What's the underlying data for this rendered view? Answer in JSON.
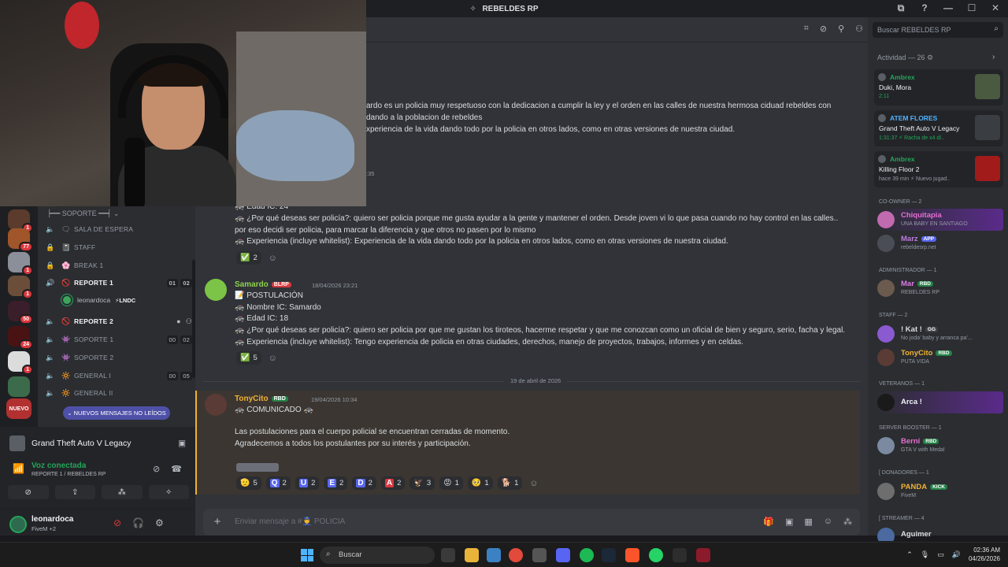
{
  "window": {
    "title": "REBELDES RP",
    "controls": [
      "⧉",
      "?",
      "—",
      "☐",
      "✕"
    ]
  },
  "sidebar": {
    "category": "SOPORTE",
    "channels": [
      {
        "emoji": "🗨",
        "name": "SALA DE ESPERA",
        "bold": false,
        "counts": []
      },
      {
        "emoji": "📓",
        "name": "STAFF",
        "bold": false,
        "counts": []
      },
      {
        "emoji": "🌸",
        "name": "BREAK 1",
        "bold": false,
        "counts": []
      },
      {
        "emoji": "🚫",
        "name": "REPORTE 1",
        "bold": true,
        "counts": [
          "01",
          "02"
        ]
      },
      {
        "emoji": "🚫",
        "name": "REPORTE 2",
        "bold": true,
        "counts": []
      },
      {
        "emoji": "👾",
        "name": "SOPORTE 1",
        "bold": false,
        "counts": [
          "00",
          "02"
        ]
      },
      {
        "emoji": "👾",
        "name": "SOPORTE 2",
        "bold": false,
        "counts": []
      },
      {
        "emoji": "🔆",
        "name": "GENERAL I",
        "bold": false,
        "counts": [
          "00",
          "05"
        ]
      },
      {
        "emoji": "🔆",
        "name": "GENERAL II",
        "bold": false,
        "counts": []
      }
    ],
    "voice_user": {
      "name": "leonardoca",
      "tag": "⚡LNDC"
    },
    "new_messages_label": "NUEVOS MENSAJES NO LEÍDOS",
    "rail_badges": [
      "1",
      "77",
      "1",
      "1",
      "50",
      "24",
      "1"
    ],
    "rail_new_label": "NUEVO"
  },
  "voice_panel": {
    "game": "Grand Theft Auto V Legacy",
    "status": "Voz conectada",
    "channel": "REPORTE 1 / REBELDES RP",
    "user_name": "leonardoca",
    "user_status": "FiveM +2"
  },
  "chat": {
    "channel_placeholder": "Enviar mensaje a #👮 POLICIA",
    "messages_top": [
      "ardo es un policia muy respetuoso con la dedicacion a cumplir la ley y el orden en las calles de nuestra hermosa ciduad rebeldes con",
      "dando a la poblacion de rebeldes",
      "xperiencia de la vida dando todo por la policia en otros lados, como en otras versiones de nuestra ciudad."
    ],
    "partial_time": ":35",
    "msg2_lines": [
      "🚓 Edad IC: 24",
      "🚓 ¿Por qué deseas ser policía?: quiero ser policia porque me gusta ayudar a la gente y mantener el orden. Desde joven vi lo que pasa cuando no hay control en las calles..",
      "por eso decidi ser policia, para marcar la diferencia y que otros no pasen por lo mismo",
      "🚓 Experiencia (incluye whitelist):  Experiencia de la vida dando todo por la policia en otros lados, como en otras versiones de nuestra ciudad."
    ],
    "msg2_reactions": [
      {
        "e": "✅",
        "n": "2"
      }
    ],
    "msg3": {
      "author": "Samardo",
      "tag": "BLRP",
      "time": "18/04/2026 23:21",
      "lines": [
        "📝 POSTULACIÓN",
        "🚓 Nombre IC: Samardo",
        "🚓 Edad IC: 18",
        "🚓 ¿Por qué deseas ser policía?: quiero ser policia por que me gustan los tiroteos, hacerme respetar y que me conozcan como un oficial de bien y seguro, serio, facha y legal.",
        "🚓 Experiencia (incluye whitelist):  Tengo experiencia de policia en otras ciudades, derechos, manejo de proyectos, trabajos, informes y en celdas."
      ],
      "reactions": [
        {
          "e": "✅",
          "n": "5"
        }
      ]
    },
    "date_divider": "19 de abril de 2026",
    "msg4": {
      "author": "TonyCito",
      "tag": "RBD",
      "time": "19/04/2026 10:34",
      "title": "🚓 COMUNICADO 🚓",
      "lines": [
        "Las postulaciones para el cuerpo policial se encuentran cerradas de momento.",
        "Agradecemos a todos los postulantes por su interés y participación."
      ],
      "reactions": [
        {
          "e": "🫡",
          "n": "5"
        },
        {
          "e": "Q",
          "n": "2"
        },
        {
          "e": "U",
          "n": "2"
        },
        {
          "e": "E",
          "n": "2"
        },
        {
          "e": "D",
          "n": "2"
        },
        {
          "e": "A",
          "n": "2"
        },
        {
          "e": "🦅",
          "n": "3"
        },
        {
          "e": "😡",
          "n": "1"
        },
        {
          "e": "🥺",
          "n": "1"
        },
        {
          "e": "🐕",
          "n": "1"
        }
      ]
    }
  },
  "members": {
    "search_placeholder": "Buscar REBELDES RP",
    "activity_title": "Actividad — 26",
    "activities": [
      {
        "name": "Ambrex",
        "game": "Duki, Mora",
        "time": "2:11"
      },
      {
        "name": "ATEM FLORES",
        "game": "Grand Theft Auto V Legacy",
        "time": "1:31:37 ⚡ Racha de x4 dí.."
      },
      {
        "name": "Ambrex",
        "game": "Killing Floor 2",
        "time": "hace 39 min ⚡ Nuevo jugad.."
      }
    ],
    "roles": [
      {
        "label": "CO-OWNER — 2",
        "members": [
          {
            "name": "Chiquitapia",
            "sub": "UNA BABY EN SANTIAGO",
            "color": "#e56fd1",
            "pill": "",
            "glow": true
          },
          {
            "name": "Marz",
            "sub": "rebeldesrp.net",
            "color": "#c07ae0",
            "pill": "APP",
            "glow": false
          }
        ]
      },
      {
        "label": "ADMINISTRADOR — 1",
        "members": [
          {
            "name": "Mar",
            "sub": "REBELDES RP",
            "color": "#e07ae8",
            "pill": "RBD",
            "glow": false
          }
        ]
      },
      {
        "label": "STAFF — 2",
        "members": [
          {
            "name": "! Kat !",
            "sub": "No joda' baby y arranca pa'...",
            "color": "#dbdee1",
            "pill": "GG",
            "glow": false
          },
          {
            "name": "TonyCito",
            "sub": "PUTA VIDA",
            "color": "#f0b232",
            "pill": "RBD",
            "glow": false
          }
        ]
      },
      {
        "label": "VETERANOS — 1",
        "members": [
          {
            "name": "Arca !",
            "sub": "",
            "color": "#f2f3f5",
            "pill": "",
            "glow": true
          }
        ]
      },
      {
        "label": "SERVER BOOSTER — 1",
        "members": [
          {
            "name": "Berni",
            "sub": "GTA V with Medal",
            "color": "#e56fd1",
            "pill": "RBD",
            "glow": false
          }
        ]
      },
      {
        "label": "[ DONADORES — 1",
        "members": [
          {
            "name": "PANDA",
            "sub": "FiveM",
            "color": "#f0b232",
            "pill": "KICK",
            "glow": false
          }
        ]
      },
      {
        "label": "[ STREAMER — 4",
        "members": [
          {
            "name": "Aguimer",
            "sub": "",
            "color": "#dbdee1",
            "pill": "",
            "glow": false
          }
        ]
      }
    ]
  },
  "taskbar": {
    "search": "Buscar",
    "time": "02:36 AM",
    "date": "04/26/2026"
  },
  "colors": {
    "accent": "#5865f2",
    "online": "#23a55a",
    "danger": "#da373c"
  }
}
